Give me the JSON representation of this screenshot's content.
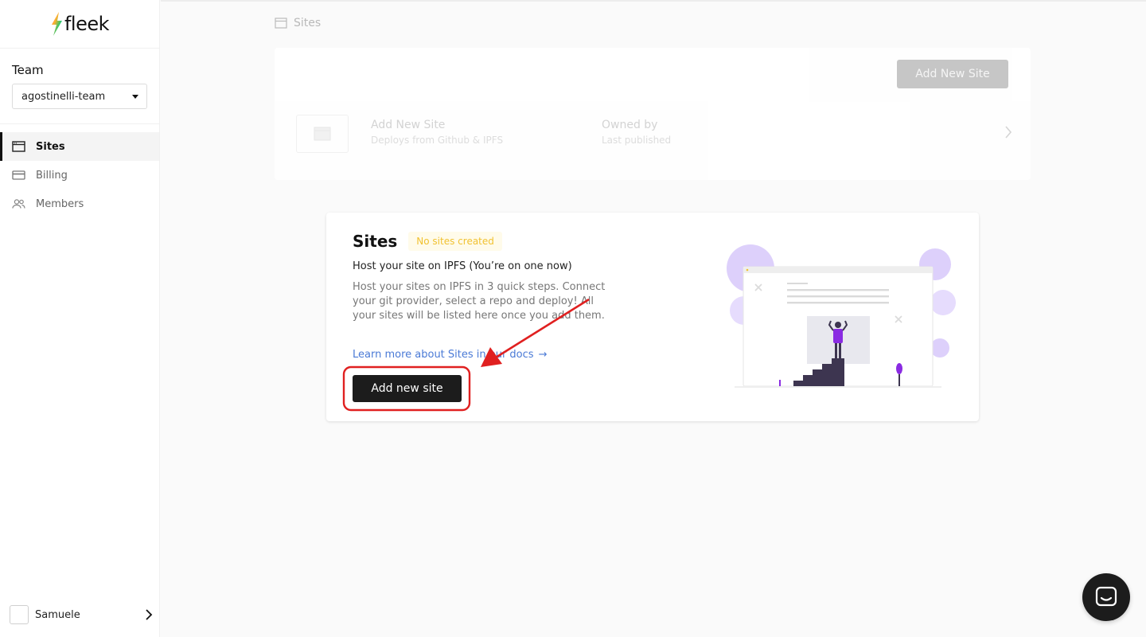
{
  "brand": {
    "name": "fleek"
  },
  "sidebar": {
    "team_label": "Team",
    "team_selected": "agostinelli-team",
    "items": [
      {
        "label": "Sites",
        "icon": "browser-window-icon",
        "active": true
      },
      {
        "label": "Billing",
        "icon": "credit-card-icon",
        "active": false
      },
      {
        "label": "Members",
        "icon": "users-icon",
        "active": false
      }
    ],
    "user": {
      "name": "Samuele"
    }
  },
  "breadcrumb": {
    "label": "Sites"
  },
  "ghost_list": {
    "add_button": "Add New Site",
    "row": {
      "title": "Add New Site",
      "subtitle": "Deploys from Github & IPFS",
      "owner_title": "Owned by",
      "owner_subtitle": "Last published"
    }
  },
  "empty_state": {
    "title": "Sites",
    "badge": "No sites created",
    "subtitle": "Host your site on IPFS (You’re on one now)",
    "description": "Host your sites on IPFS in 3 quick steps. Connect your git provider, select a repo and deploy! All your sites will be listed here once you add them.",
    "link": "Learn more about Sites in our docs",
    "link_arrow": "→",
    "button": "Add new site"
  },
  "colors": {
    "accent_purple": "#8a2be2",
    "annotation_red": "#e02020",
    "badge_text": "#f1c232",
    "link": "#4a7ad6"
  }
}
